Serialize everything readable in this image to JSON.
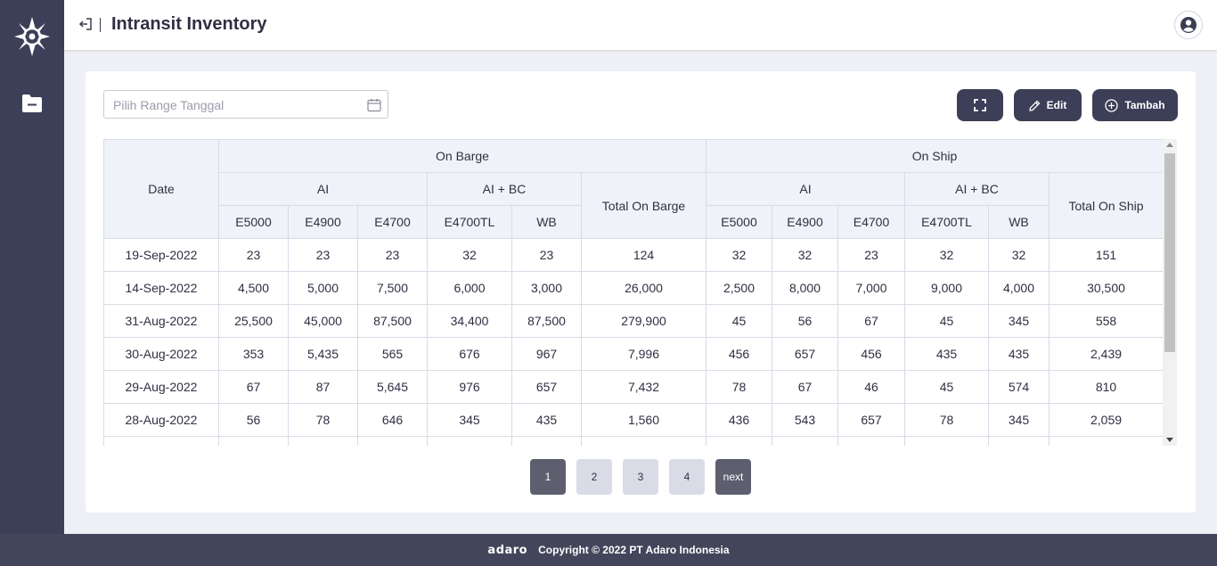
{
  "header": {
    "title": "Intransit Inventory"
  },
  "filter": {
    "date_placeholder": "Pilih Range Tanggal"
  },
  "toolbar": {
    "edit_label": "Edit",
    "add_label": "Tambah"
  },
  "table": {
    "group_headers": {
      "date": "Date",
      "on_barge": "On Barge",
      "on_ship": "On Ship"
    },
    "sub_headers": {
      "barge_ai": "AI",
      "barge_aibc": "AI + BC",
      "total_on_barge": "Total On Barge",
      "ship_ai": "AI",
      "ship_aibc": "AI + BC",
      "total_on_ship": "Total On Ship"
    },
    "columns": {
      "barge_e5000": "E5000",
      "barge_e4900": "E4900",
      "barge_e4700": "E4700",
      "barge_e4700tl": "E4700TL",
      "barge_wb": "WB",
      "ship_e5000": "E5000",
      "ship_e4900": "E4900",
      "ship_e4700": "E4700",
      "ship_e4700tl": "E4700TL",
      "ship_wb": "WB"
    },
    "rows": [
      [
        "19-Sep-2022",
        "23",
        "23",
        "23",
        "32",
        "23",
        "124",
        "32",
        "32",
        "23",
        "32",
        "32",
        "151"
      ],
      [
        "14-Sep-2022",
        "4,500",
        "5,000",
        "7,500",
        "6,000",
        "3,000",
        "26,000",
        "2,500",
        "8,000",
        "7,000",
        "9,000",
        "4,000",
        "30,500"
      ],
      [
        "31-Aug-2022",
        "25,500",
        "45,000",
        "87,500",
        "34,400",
        "87,500",
        "279,900",
        "45",
        "56",
        "67",
        "45",
        "345",
        "558"
      ],
      [
        "30-Aug-2022",
        "353",
        "5,435",
        "565",
        "676",
        "967",
        "7,996",
        "456",
        "657",
        "456",
        "435",
        "435",
        "2,439"
      ],
      [
        "29-Aug-2022",
        "67",
        "87",
        "5,645",
        "976",
        "657",
        "7,432",
        "78",
        "67",
        "46",
        "45",
        "574",
        "810"
      ],
      [
        "28-Aug-2022",
        "56",
        "78",
        "646",
        "345",
        "435",
        "1,560",
        "436",
        "543",
        "657",
        "78",
        "345",
        "2,059"
      ]
    ]
  },
  "pagination": {
    "pages": [
      "1",
      "2",
      "3",
      "4"
    ],
    "next_label": "next",
    "active_page": "1"
  },
  "footer": {
    "logo_text": "adaro",
    "copyright": "Copyright © 2022 PT Adaro Indonesia"
  },
  "colors": {
    "sidebar": "#3d3f58",
    "button": "#3d3f58",
    "header_cell": "#f0f2f9",
    "footer": "#43455b"
  },
  "icons": {
    "logo": "compass-star-icon",
    "sidebar_folder": "folder-icon",
    "back": "logout-arrow-icon",
    "user": "user-circle-icon",
    "calendar": "calendar-icon",
    "expand": "fullscreen-icon",
    "edit": "pencil-icon",
    "add": "plus-circle-icon"
  }
}
